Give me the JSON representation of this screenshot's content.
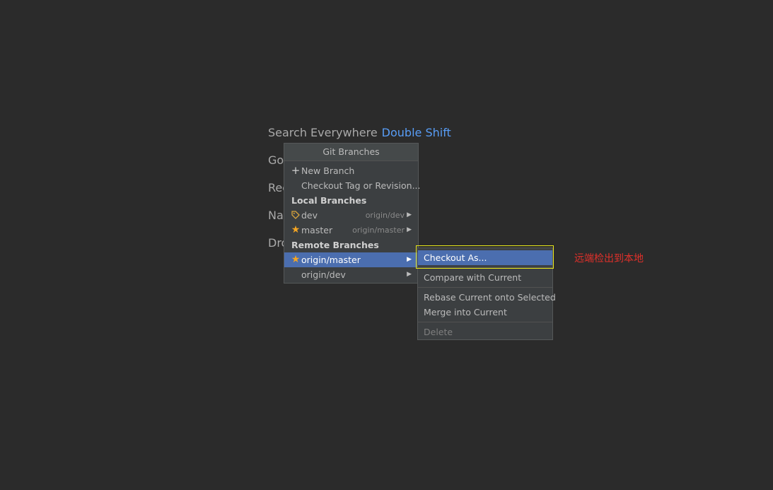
{
  "hints": {
    "search": {
      "text": "Search Everywhere",
      "shortcut": "Double Shift"
    },
    "line2": "Go",
    "line3": "Rec",
    "line4": "Na",
    "line5": "Dro"
  },
  "popup": {
    "title": "Git Branches",
    "actions": [
      {
        "label": "New Branch",
        "icon": "plus-icon"
      },
      {
        "label": "Checkout Tag or Revision...",
        "icon": ""
      }
    ],
    "local_header": "Local Branches",
    "local": [
      {
        "name": "dev",
        "tracking": "origin/dev",
        "icon": "tag-icon"
      },
      {
        "name": "master",
        "tracking": "origin/master",
        "icon": "star-icon"
      }
    ],
    "remote_header": "Remote Branches",
    "remote": [
      {
        "name": "origin/master",
        "icon": "star-icon",
        "selected": true
      },
      {
        "name": "origin/dev",
        "icon": "",
        "selected": false
      }
    ]
  },
  "submenu": {
    "items": [
      {
        "label": "Checkout As...",
        "selected": true
      },
      {
        "label": "Compare with Current"
      },
      {
        "label": "Rebase Current onto Selected"
      },
      {
        "label": "Merge into Current"
      },
      {
        "label": "Delete",
        "disabled": true
      }
    ]
  },
  "annotation": "远端检出到本地",
  "colors": {
    "background": "#2b2b2b",
    "popup": "#3c3f41",
    "selection": "#4b6eaf",
    "shortcut": "#589df6",
    "star": "#f5a623",
    "highlight_box": "#e8e81a",
    "annotation": "#e0302a"
  }
}
